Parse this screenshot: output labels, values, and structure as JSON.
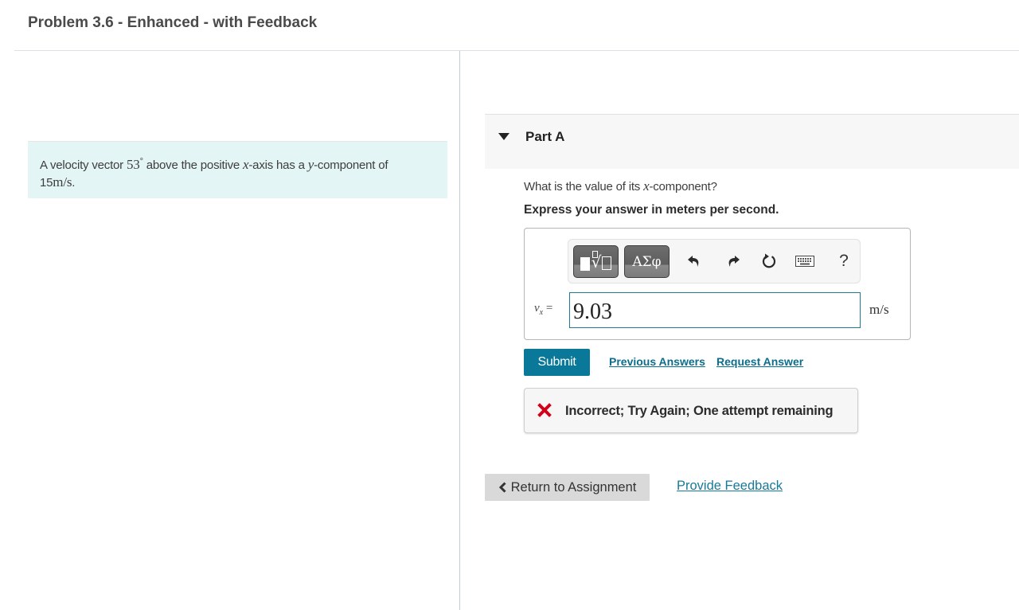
{
  "page": {
    "title": "Problem 3.6 - Enhanced - with Feedback"
  },
  "intro": {
    "text_before_angle": "A velocity vector ",
    "angle_value": "53",
    "angle_unit": "°",
    "text_after_angle": " above the positive ",
    "x_var": "x",
    "text_mid": "-axis has a ",
    "y_var": "y",
    "text_end": "-component of",
    "magnitude": "15",
    "magnitude_unit": "m/s",
    "period": "."
  },
  "part": {
    "label": "Part A",
    "expanded": true,
    "question_before": "What is the value of its ",
    "question_var": "x",
    "question_after": "-component?",
    "instruction": "Express your answer in meters per second."
  },
  "toolbar": {
    "templates_icon": "templates-root-icon",
    "symbols_label": "ΑΣφ",
    "undo_icon": "undo-icon",
    "redo_icon": "redo-icon",
    "reset_icon": "reset-icon",
    "keyboard_icon": "keyboard-icon",
    "help_label": "?"
  },
  "answer": {
    "variable": "v",
    "subscript": "x",
    "equals": "=",
    "value": "9.03",
    "unit": "m/s"
  },
  "actions": {
    "submit_label": "Submit",
    "previous_answers_label": "Previous Answers",
    "request_answer_label": "Request Answer"
  },
  "feedback": {
    "status": "incorrect",
    "message": "Incorrect; Try Again; One attempt remaining",
    "icon_color": "#d0021b"
  },
  "footer": {
    "return_label": "Return to Assignment",
    "provide_feedback_label": "Provide Feedback"
  },
  "colors": {
    "accent": "#0a7898",
    "intro_bg": "#e4f5f6",
    "part_header_bg": "#f7f7f7",
    "link": "#0b6e8c"
  }
}
